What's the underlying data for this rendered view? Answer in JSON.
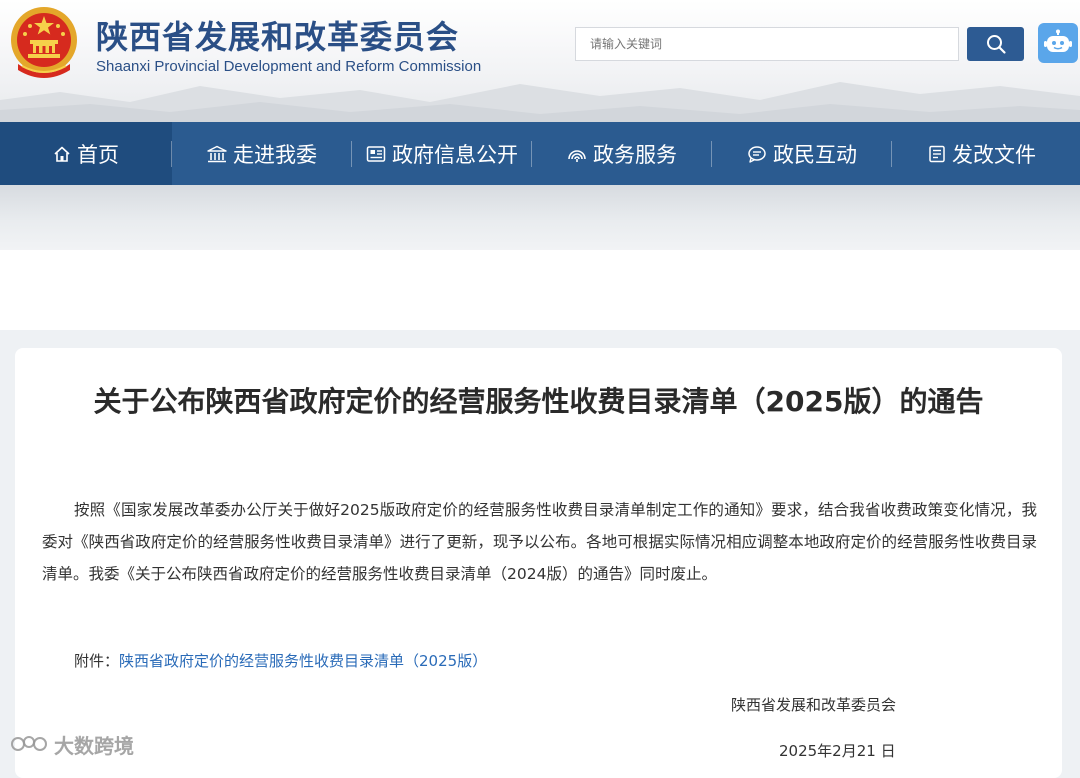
{
  "header": {
    "title": "陕西省发展和改革委员会",
    "subtitle": "Shaanxi Provincial Development and Reform Commission",
    "search_placeholder": "请输入关键词",
    "emblem_icon": "national-emblem-icon",
    "search_icon": "search-icon",
    "robot_icon": "robot-assistant-icon"
  },
  "nav": {
    "items": [
      {
        "label": "首页",
        "icon": "home-icon"
      },
      {
        "label": "走进我委",
        "icon": "building-icon"
      },
      {
        "label": "政府信息公开",
        "icon": "info-board-icon"
      },
      {
        "label": "政务服务",
        "icon": "service-signal-icon"
      },
      {
        "label": "政民互动",
        "icon": "chat-icon"
      },
      {
        "label": "发改文件",
        "icon": "document-icon"
      }
    ],
    "active_index": 0
  },
  "article": {
    "title": "关于公布陕西省政府定价的经营服务性收费目录清单（2025版）的通告",
    "body": "按照《国家发展改革委办公厅关于做好2025版政府定价的经营服务性收费目录清单制定工作的通知》要求，结合我省收费政策变化情况，我委对《陕西省政府定价的经营服务性收费目录清单》进行了更新，现予以公布。各地可根据实际情况相应调整本地政府定价的经营服务性收费目录清单。我委《关于公布陕西省政府定价的经营服务性收费目录清单（2024版）的通告》同时废止。",
    "attachment_label": "附件：",
    "attachment_link": "陕西省政府定价的经营服务性收费目录清单（2025版）",
    "signature": "陕西省发展和改革委员会",
    "date": "2025年2月21 日"
  },
  "watermark": {
    "text": "大数跨境"
  },
  "colors": {
    "brand_blue": "#2a4f86",
    "nav_bg": "#2b5b90",
    "nav_active": "#1f4c7e",
    "link": "#2a6bb8",
    "robot_bg": "#5aa6ea"
  }
}
